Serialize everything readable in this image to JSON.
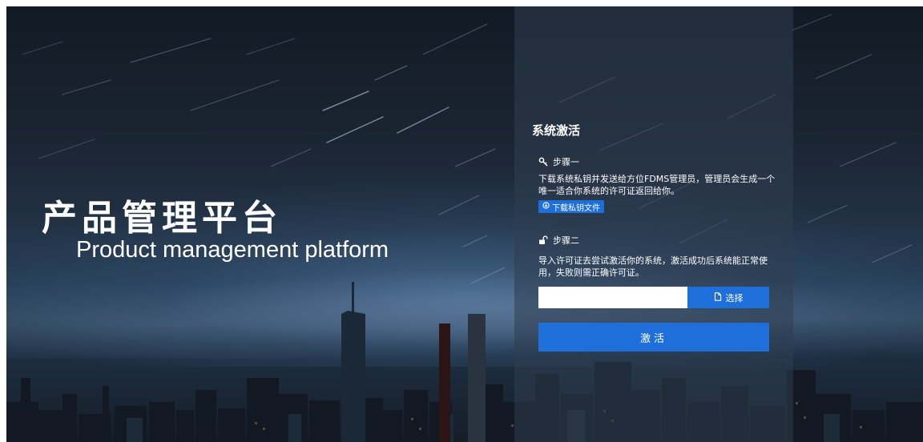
{
  "brand": {
    "title": "产品管理平台",
    "subtitle": "Product management platform"
  },
  "activation": {
    "title": "系统激活",
    "step1": {
      "icon": "key-icon",
      "label": "步骤一",
      "description": "下载系统私钥并发送给方位FDMS管理员，管理员会生成一个唯一适合你系统的许可证返回给你。",
      "download_label": "下载私钥文件",
      "download_icon": "download-circle-icon"
    },
    "step2": {
      "icon": "unlock-icon",
      "label": "步骤二",
      "description": "导入许可证去尝试激活你的系统，激活成功后系统能正常使用，失败则需正确许可证。",
      "file_value": "",
      "choose_label": "选择",
      "choose_icon": "file-icon"
    },
    "activate_label": "激活"
  },
  "colors": {
    "accent": "#1e6fd9",
    "text": "#ffffff",
    "panel": "rgba(48,62,80,0.55)"
  }
}
